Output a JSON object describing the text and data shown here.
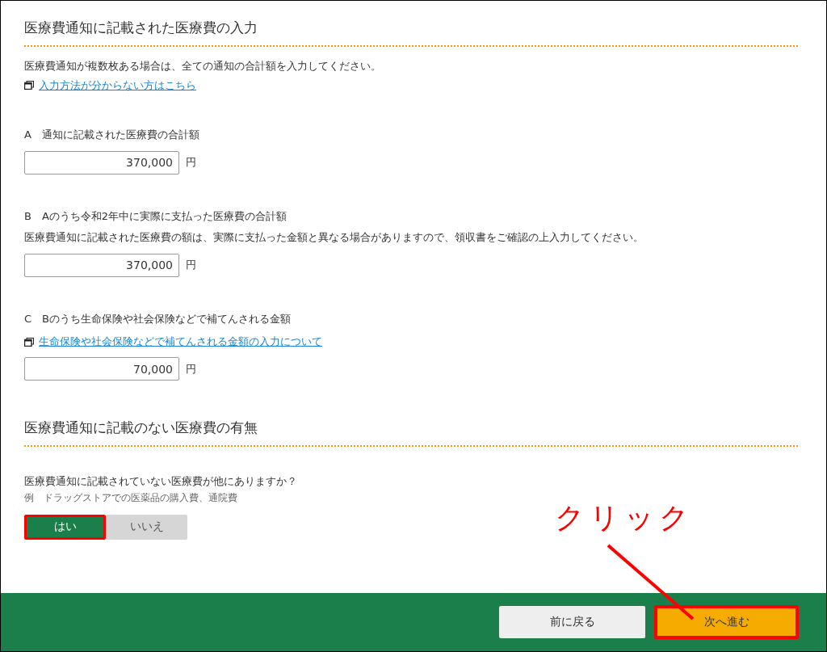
{
  "section_1": {
    "heading": "医療費通知に記載された医療費の入力",
    "intro": "医療費通知が複数枚ある場合は、全ての通知の合計額を入力してください。",
    "help_link": "入力方法が分からない方はこちら",
    "fields": [
      {
        "letter": "A",
        "label": "通知に記載された医療費の合計額",
        "value": "370,000",
        "unit": "円"
      },
      {
        "letter": "B",
        "label": "Aのうち令和2年中に実際に支払った医療費の合計額",
        "note": "医療費通知に記載された医療費の額は、実際に支払った金額と異なる場合がありますので、領収書をご確認の上入力してください。",
        "value": "370,000",
        "unit": "円"
      },
      {
        "letter": "C",
        "label": "Bのうち生命保険や社会保険などで補てんされる金額",
        "link": "生命保険や社会保険などで補てんされる金額の入力について",
        "value": "70,000",
        "unit": "円"
      }
    ]
  },
  "section_2": {
    "heading": "医療費通知に記載のない医療費の有無",
    "question": "医療費通知に記載されていない医療費が他にありますか？",
    "example": "例　ドラッグストアでの医薬品の購入費、通院費",
    "options": [
      {
        "label": "はい",
        "selected": true,
        "highlighted": true
      },
      {
        "label": "いいえ",
        "selected": false,
        "highlighted": false
      }
    ]
  },
  "footer": {
    "buttons": [
      {
        "label": "前に戻る",
        "kind": "back",
        "highlighted": false
      },
      {
        "label": "次へ進む",
        "kind": "next",
        "highlighted": true
      }
    ]
  },
  "annotation": {
    "text": "クリック"
  }
}
